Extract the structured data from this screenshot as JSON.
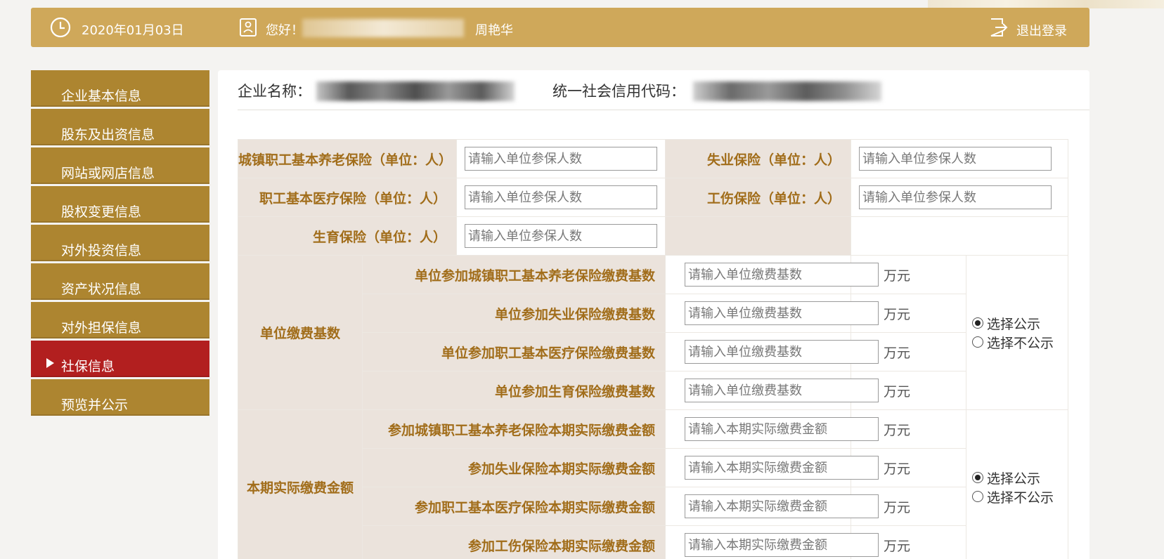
{
  "header": {
    "date": "2020年01月03日",
    "greeting": "您好！",
    "user_name": "周艳华",
    "logout_label": "退出登录"
  },
  "sidebar": {
    "items": [
      {
        "label": "企业基本信息"
      },
      {
        "label": "股东及出资信息"
      },
      {
        "label": "网站或网店信息"
      },
      {
        "label": "股权变更信息"
      },
      {
        "label": "对外投资信息"
      },
      {
        "label": "资产状况信息"
      },
      {
        "label": "对外担保信息"
      },
      {
        "label": "社保信息",
        "active": true
      },
      {
        "label": "预览并公示"
      }
    ]
  },
  "company": {
    "name_label": "企业名称：",
    "credit_code_label": "统一社会信用代码："
  },
  "insurance": {
    "pension_label": "城镇职工基本养老保险（单位：人）",
    "unemployment_label": "失业保险（单位：人）",
    "medical_label": "职工基本医疗保险（单位：人）",
    "injury_label": "工伤保险（单位：人）",
    "maternity_label": "生育保险（单位：人）",
    "headcount_placeholder": "请输入单位参保人数"
  },
  "base": {
    "group_label": "单位缴费基数",
    "rows": [
      {
        "label": "单位参加城镇职工基本养老保险缴费基数"
      },
      {
        "label": "单位参加失业保险缴费基数"
      },
      {
        "label": "单位参加职工基本医疗保险缴费基数"
      },
      {
        "label": "单位参加生育保险缴费基数"
      }
    ],
    "placeholder": "请输入单位缴费基数"
  },
  "actual": {
    "group_label": "本期实际缴费金额",
    "rows": [
      {
        "label": "参加城镇职工基本养老保险本期实际缴费金额"
      },
      {
        "label": "参加失业保险本期实际缴费金额"
      },
      {
        "label": "参加职工基本医疗保险本期实际缴费金额"
      },
      {
        "label": "参加工伤保险本期实际缴费金额"
      }
    ],
    "placeholder": "请输入本期实际缴费金额"
  },
  "unit": "万元",
  "publicity": {
    "show": "选择公示",
    "hide": "选择不公示",
    "base_selected": "show",
    "actual_selected": "show"
  },
  "colors": {
    "header_bg": "#cfa85a",
    "sidebar_bg": "#ad8530",
    "sidebar_active_bg": "#b21f1f",
    "label_text": "#a16d1a",
    "label_bg": "#ebe3dc"
  }
}
